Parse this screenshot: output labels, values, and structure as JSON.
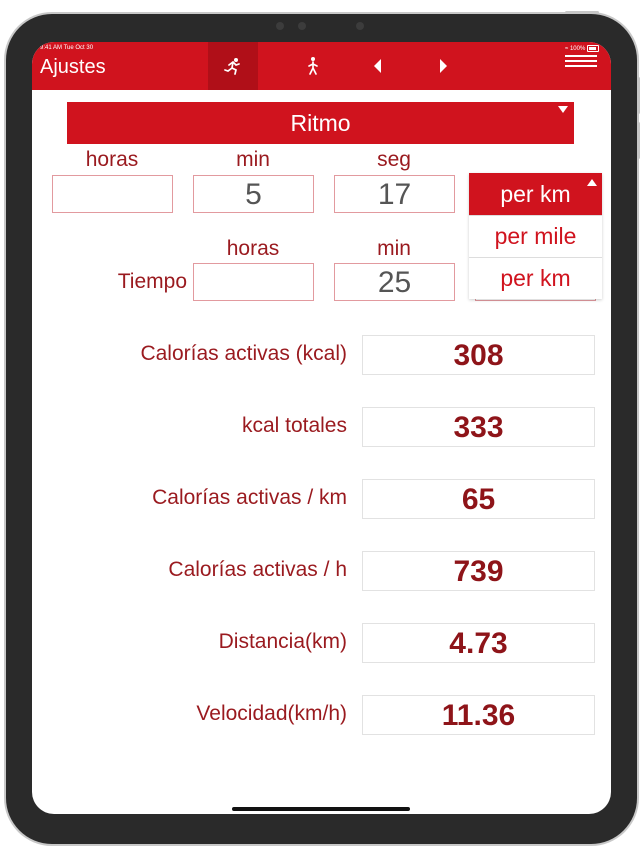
{
  "status": {
    "time_date": "9:41 AM  Tue Oct 30",
    "battery": "100%"
  },
  "nav": {
    "title": "Ajustes"
  },
  "icons": {
    "run": "runner-icon",
    "walk": "walker-icon",
    "prev": "chevron-left-icon",
    "next": "chevron-right-icon",
    "menu": "hamburger-menu-icon"
  },
  "mode": {
    "label": "Ritmo"
  },
  "pace": {
    "labels": {
      "hours": "horas",
      "min": "min",
      "sec": "seg"
    },
    "hours": "",
    "minutes": "5",
    "seconds": "17"
  },
  "unit_dropdown": {
    "selected": "per km",
    "options": [
      "per mile",
      "per km"
    ]
  },
  "time": {
    "row_label": "Tiempo",
    "labels": {
      "hours": "horas",
      "min": "min"
    },
    "hours": "",
    "minutes": "25"
  },
  "results": [
    {
      "label": "Calorías activas (kcal)",
      "value": "308"
    },
    {
      "label": "kcal totales",
      "value": "333"
    },
    {
      "label": "Calorías activas / km",
      "value": "65"
    },
    {
      "label": "Calorías activas / h",
      "value": "739"
    },
    {
      "label": "Distancia(km)",
      "value": "4.73"
    },
    {
      "label": "Velocidad(km/h)",
      "value": "11.36"
    }
  ],
  "colors": {
    "accent": "#d0131e",
    "label_text": "#9a1a1f",
    "value_text": "#8e1419"
  }
}
